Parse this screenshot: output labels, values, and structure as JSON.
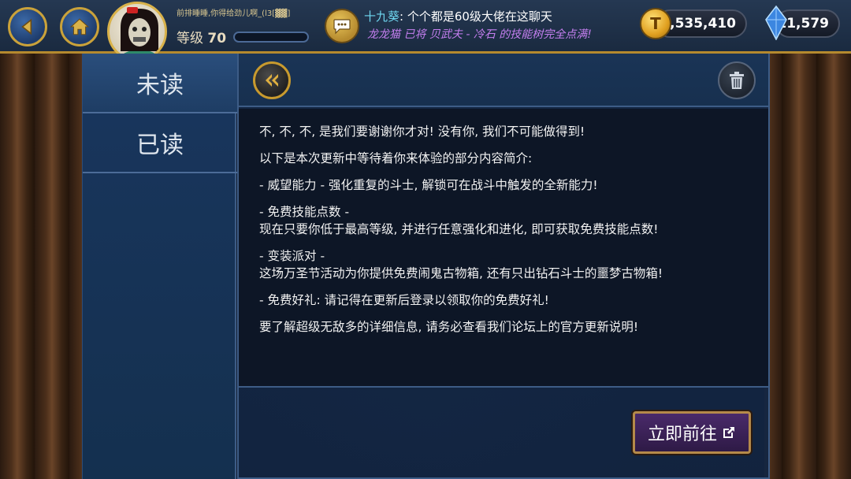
{
  "topbar": {
    "player_name": "前排睡睡,你得给劲儿啊_(l3[▓▓]",
    "level_label": "等级",
    "level_value": "70",
    "chat_sender": "十九葵",
    "chat_message": ": 个个都是60级大佬在这聊天",
    "system_message": "龙龙猫 已将 贝武夫 - 冷石 的技能树完全点满!",
    "gold": "32,535,410",
    "gems": "11,579"
  },
  "sidebar": {
    "tabs": [
      {
        "label": "未读"
      },
      {
        "label": "已读"
      }
    ]
  },
  "message": {
    "paragraphs": [
      "不, 不, 不, 是我们要谢谢你才对! 没有你, 我们不可能做得到!",
      "以下是本次更新中等待着你来体验的部分内容简介:",
      "- 威望能力 - 强化重复的斗士, 解锁可在战斗中触发的全新能力!",
      "- 免费技能点数 -",
      "现在只要你低于最高等级, 并进行任意强化和进化, 即可获取免费技能点数!",
      "- 变装派对 -",
      "这场万圣节活动为你提供免费闹鬼古物箱, 还有只出钻石斗士的噩梦古物箱!",
      "- 免费好礼: 请记得在更新后登录以领取你的免费好礼!",
      "要了解超级无敌多的详细信息, 请务必查看我们论坛上的官方更新说明!"
    ]
  },
  "actions": {
    "go_label": "立即前往"
  },
  "colors": {
    "accent_gold": "#caa23a",
    "panel_blue": "#19365e",
    "button_purple": "#4a2a6a"
  }
}
